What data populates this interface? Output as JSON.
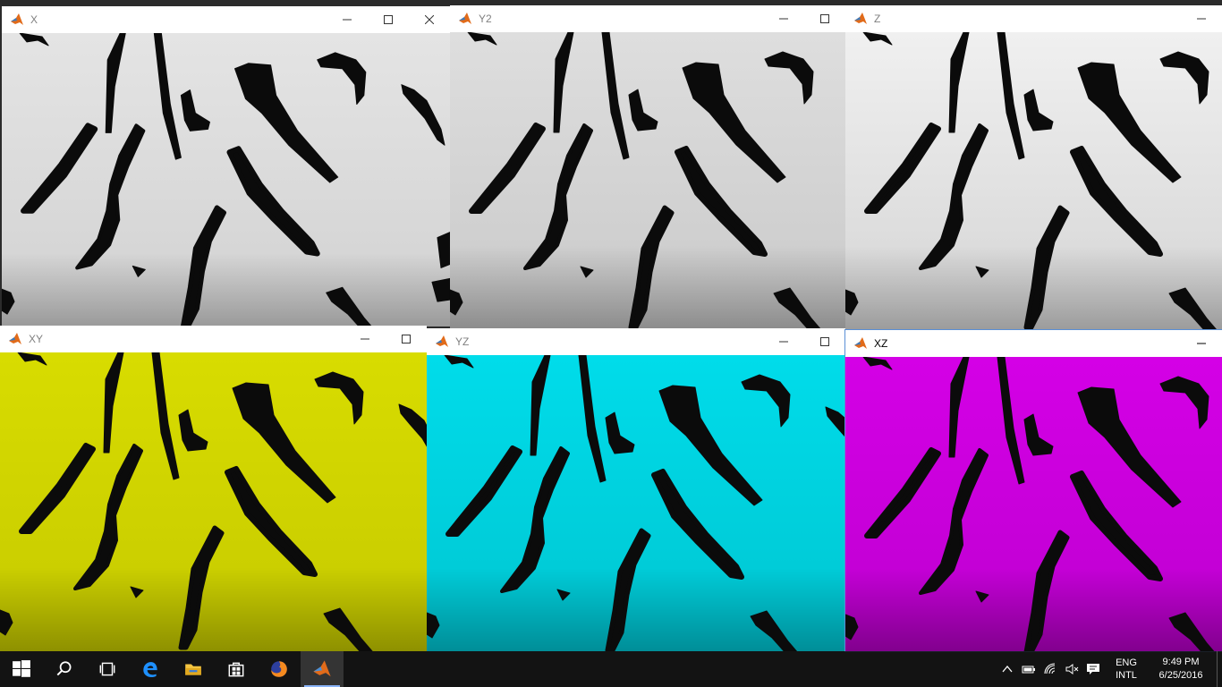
{
  "windows": [
    {
      "id": "X",
      "title": "X",
      "tint": "#e6e6e6",
      "tint2": "#b4b4b4",
      "controls": [
        "minimize",
        "maximize",
        "close"
      ]
    },
    {
      "id": "Y2",
      "title": "Y2",
      "tint": "#e2e2e2",
      "tint2": "#aaaaaa",
      "controls": [
        "minimize",
        "maximize"
      ]
    },
    {
      "id": "Z",
      "title": "Z",
      "tint": "#ebebeb",
      "tint2": "#b8b8b8",
      "controls": [
        "minimize"
      ]
    },
    {
      "id": "XY",
      "title": "XY",
      "tint": "#d4d800",
      "tint2": "#a3a600",
      "controls": [
        "minimize",
        "maximize"
      ]
    },
    {
      "id": "YZ",
      "title": "YZ",
      "tint": "#00d8e6",
      "tint2": "#00a6b2",
      "controls": [
        "minimize",
        "maximize"
      ]
    },
    {
      "id": "XZ",
      "title": "XZ",
      "tint": "#cf00e0",
      "tint2": "#9a00a8",
      "controls": [
        "minimize"
      ]
    }
  ],
  "taskbar": {
    "apps": [
      "start-icon",
      "search-icon",
      "task-view-icon",
      "edge-icon",
      "file-explorer-icon",
      "store-icon",
      "firefox-icon",
      "matlab-icon"
    ],
    "language": {
      "line1": "ENG",
      "line2": "INTL"
    },
    "clock": {
      "time": "9:49 PM",
      "date": "6/25/2016"
    }
  }
}
